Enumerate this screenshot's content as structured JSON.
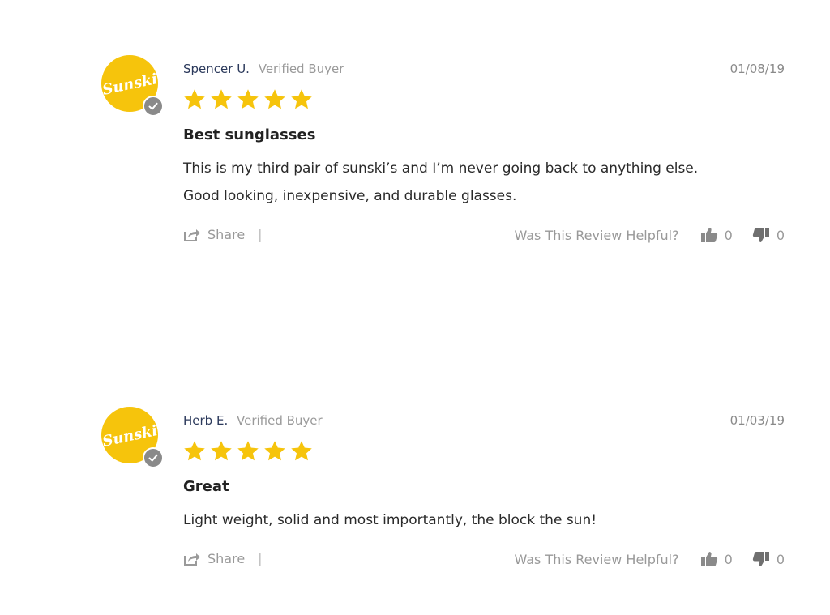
{
  "brand": {
    "accent": "#f6c40c",
    "star_color": "#f6c40c",
    "logo_text": "Sunski"
  },
  "reviews": [
    {
      "author": "Spencer U.",
      "badge": "Verified Buyer",
      "date": "01/08/19",
      "rating": 5,
      "title": "Best sunglasses",
      "body_lines": [
        "This is my third pair of sunski’s and I’m never going back to anything else.",
        "Good looking, inexpensive, and durable glasses."
      ],
      "share_label": "Share",
      "separator": "|",
      "helpful_label": "Was This Review Helpful?",
      "helpful_up": "0",
      "helpful_down": "0"
    },
    {
      "author": "Herb E.",
      "badge": "Verified Buyer",
      "date": "01/03/19",
      "rating": 5,
      "title": "Great",
      "body_lines": [
        "Light weight, solid and most importantly, the block the sun!"
      ],
      "share_label": "Share",
      "separator": "|",
      "helpful_label": "Was This Review Helpful?",
      "helpful_up": "0",
      "helpful_down": "0"
    }
  ]
}
